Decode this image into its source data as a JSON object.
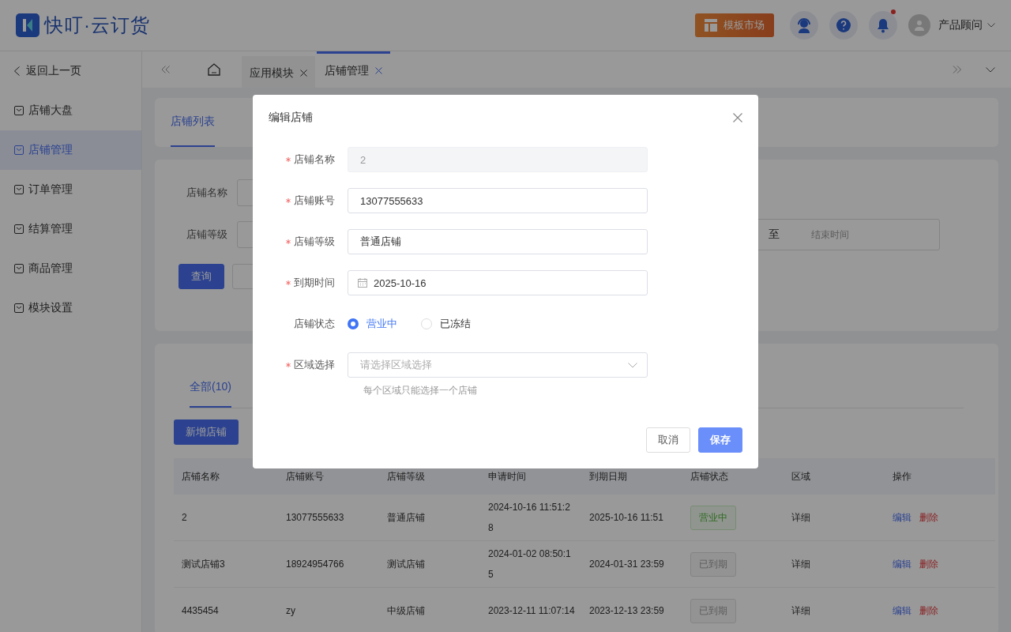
{
  "header": {
    "logo_text": "快叮·云订货",
    "template_button": "模板市场",
    "user_name": "产品顾问"
  },
  "sidebar": {
    "back": "返回上一页",
    "items": [
      {
        "label": "店铺大盘",
        "selected": false
      },
      {
        "label": "店铺管理",
        "selected": true
      },
      {
        "label": "订单管理",
        "selected": false
      },
      {
        "label": "结算管理",
        "selected": false
      },
      {
        "label": "商品管理",
        "selected": false
      },
      {
        "label": "模块设置",
        "selected": false
      }
    ]
  },
  "page_tabs": [
    {
      "label": "应用模块",
      "selected": false
    },
    {
      "label": "店铺管理",
      "selected": true
    }
  ],
  "section_tabs": [
    {
      "label": "店铺列表",
      "selected": true
    }
  ],
  "filters": [
    {
      "label": "店铺名称"
    },
    {
      "label": "店铺等级"
    }
  ],
  "date_range": {
    "separator": "至",
    "end_placeholder": "结束时间"
  },
  "filter_buttons": [
    {
      "label": "查询",
      "kind": "primary"
    },
    {
      "kind": "default"
    }
  ],
  "list": {
    "tabs": [
      {
        "label": "全部(10)",
        "selected": true
      }
    ],
    "add_button": "新增店铺",
    "columns": [
      "店铺名称",
      "店铺账号",
      "店铺等级",
      "申请时间",
      "到期日期",
      "店铺状态",
      "区域",
      "操作"
    ],
    "rows": [
      {
        "name": "2",
        "account": "13077555633",
        "level": "普通店铺",
        "applied": "2024-10-16 11:51:28",
        "expiry": "2025-10-16 11:51",
        "status": {
          "label": "营业中",
          "kind": "active"
        },
        "region": "详细",
        "actions": [
          "编辑",
          "删除"
        ]
      },
      {
        "name": "测试店铺3",
        "account": "18924954766",
        "level": "测试店铺",
        "applied": "2024-01-02 08:50:15",
        "expiry": "2024-01-31 23:59",
        "status": {
          "label": "已到期",
          "kind": "expired"
        },
        "region": "详细",
        "actions": [
          "编辑",
          "删除"
        ]
      },
      {
        "name": "4435454",
        "account": "zy",
        "level": "中级店铺",
        "applied": "2023-12-11 11:07:14",
        "expiry": "2023-12-13 23:59",
        "status": {
          "label": "已到期",
          "kind": "expired"
        },
        "region": "详细",
        "actions": [
          "编辑",
          "删除"
        ]
      }
    ]
  },
  "dialog": {
    "title": "编辑店铺",
    "fields": [
      {
        "kind": "text",
        "label": "店铺名称",
        "required": true,
        "value": "2",
        "disabled": true
      },
      {
        "kind": "text",
        "label": "店铺账号",
        "required": true,
        "value": "13077555633",
        "disabled": false
      },
      {
        "kind": "text",
        "label": "店铺等级",
        "required": true,
        "value": "普通店铺",
        "disabled": false
      },
      {
        "kind": "date",
        "label": "到期时间",
        "required": true,
        "value": "2025-10-16"
      },
      {
        "kind": "radio",
        "label": "店铺状态",
        "required": false,
        "options": [
          {
            "label": "营业中",
            "selected": true
          },
          {
            "label": "已冻结",
            "selected": false
          }
        ]
      },
      {
        "kind": "select",
        "label": "区域选择",
        "required": true,
        "placeholder": "请选择区域选择",
        "hint": "每个区域只能选择一个店铺"
      }
    ],
    "buttons": [
      {
        "label": "取消",
        "kind": "default"
      },
      {
        "label": "保存",
        "kind": "primary"
      }
    ]
  }
}
